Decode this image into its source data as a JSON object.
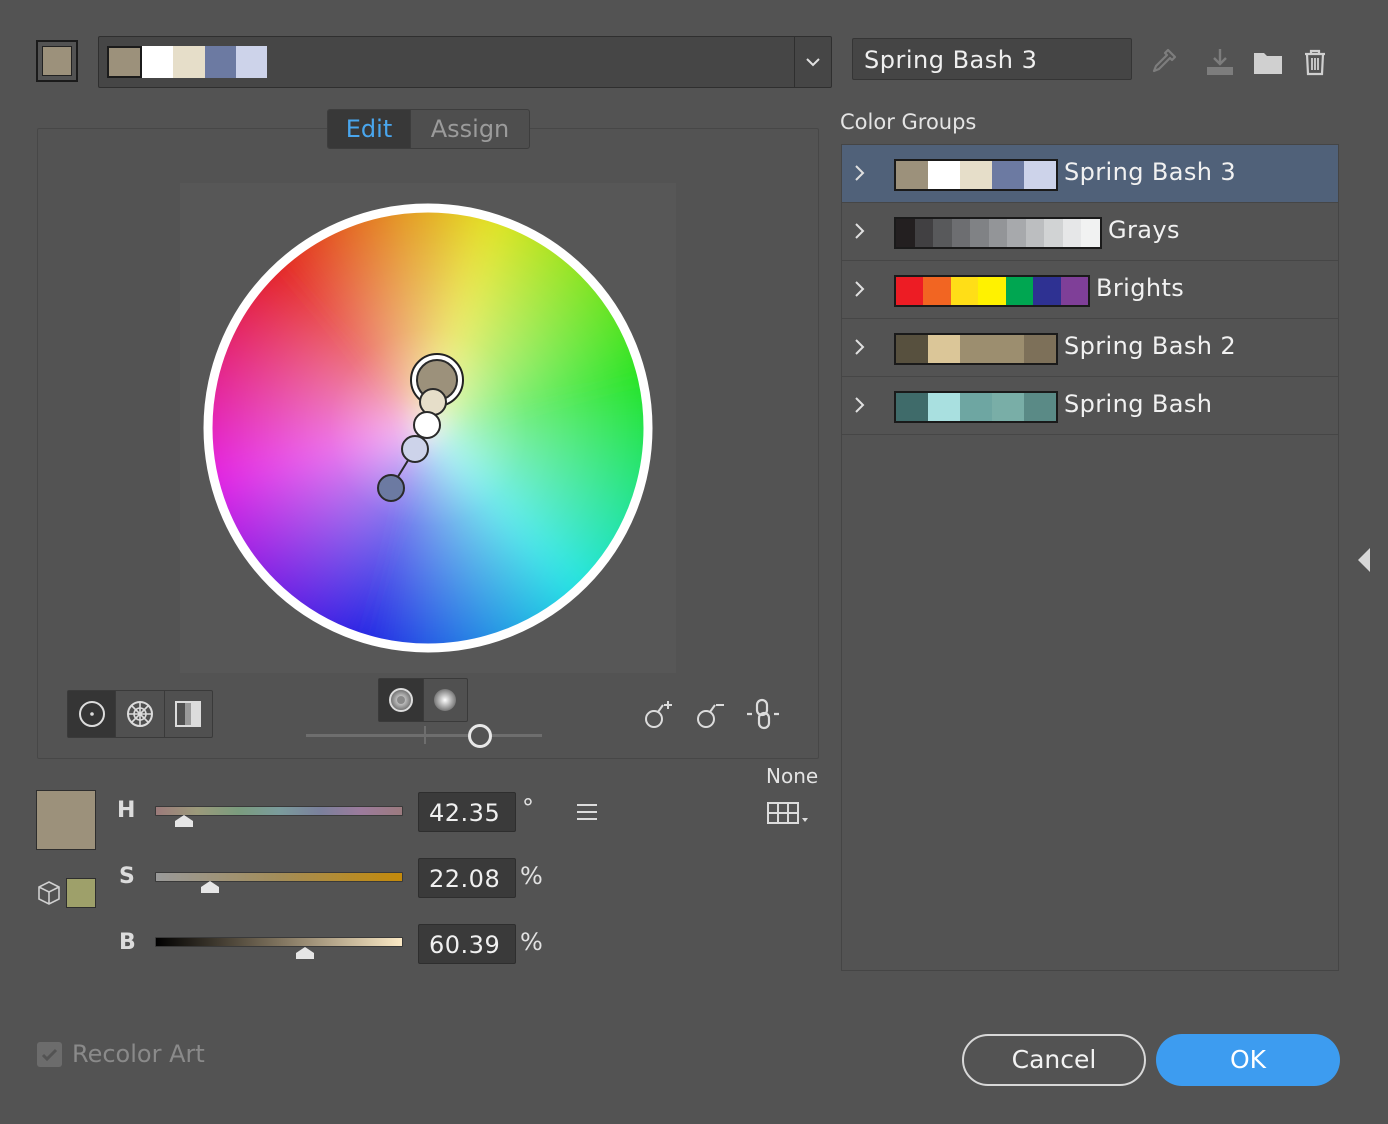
{
  "header": {
    "current_colors": [
      "#9c917b",
      "#ffffff",
      "#e6dec9",
      "#6c7aa2",
      "#cdd3ea"
    ],
    "name_value": "Spring Bash 3",
    "tools": [
      "eyedropper-icon",
      "save-icon",
      "folder-icon",
      "trash-icon"
    ]
  },
  "tabs": {
    "edit": "Edit",
    "assign": "Assign"
  },
  "wheel": {
    "markers": [
      {
        "color": "#9c917b",
        "base": true
      },
      {
        "color": "#e6dec9"
      },
      {
        "color": "#ffffff"
      },
      {
        "color": "#cdd3ea"
      },
      {
        "color": "#6c7aa2"
      }
    ]
  },
  "wheel_tools": {
    "modes": [
      "smooth-color-wheel-icon",
      "segmented-color-wheel-icon",
      "color-bars-icon"
    ],
    "brightness": [
      "show-saturation-icon",
      "show-brightness-icon"
    ],
    "actions": [
      "add-color-tool-icon",
      "remove-color-tool-icon",
      "link-harmony-icon"
    ]
  },
  "hsb": {
    "current_color": "#9c917b",
    "gamut_color": "#9ea06a",
    "h": {
      "label": "H",
      "value": "42.35",
      "unit": "°",
      "slider_fraction": 0.118
    },
    "s": {
      "label": "S",
      "value": "22.08",
      "unit": "%",
      "slider_fraction": 0.22
    },
    "b": {
      "label": "B",
      "value": "60.39",
      "unit": "%",
      "slider_fraction": 0.604
    }
  },
  "limit": {
    "label": "None"
  },
  "color_groups": {
    "title": "Color Groups",
    "groups": [
      {
        "name": "Spring Bash 3",
        "selected": true,
        "colors": [
          "#9c917b",
          "#ffffff",
          "#e6dec9",
          "#6c7aa2",
          "#cdd3ea"
        ]
      },
      {
        "name": "Grays",
        "selected": false,
        "colors": [
          "#231f20",
          "#414042",
          "#58595b",
          "#6d6e71",
          "#808285",
          "#939598",
          "#a7a9ac",
          "#bcbec0",
          "#d1d3d4",
          "#e6e7e8",
          "#f1f2f2"
        ]
      },
      {
        "name": "Brights",
        "selected": false,
        "colors": [
          "#ed1c24",
          "#f26522",
          "#ffde17",
          "#fff200",
          "#00a651",
          "#2e3192",
          "#7f3f98"
        ]
      },
      {
        "name": "Spring Bash 2",
        "selected": false,
        "colors": [
          "#57503e",
          "#dbc698",
          "#9c8e6f",
          "#9c8e6f",
          "#7d7059"
        ]
      },
      {
        "name": "Spring Bash",
        "selected": false,
        "colors": [
          "#3f6b6a",
          "#a9e0e0",
          "#6ea6a2",
          "#79aea7",
          "#5a8a86"
        ]
      }
    ]
  },
  "footer": {
    "recolor_label": "Recolor Art",
    "recolor_checked": true,
    "cancel_label": "Cancel",
    "ok_label": "OK"
  }
}
